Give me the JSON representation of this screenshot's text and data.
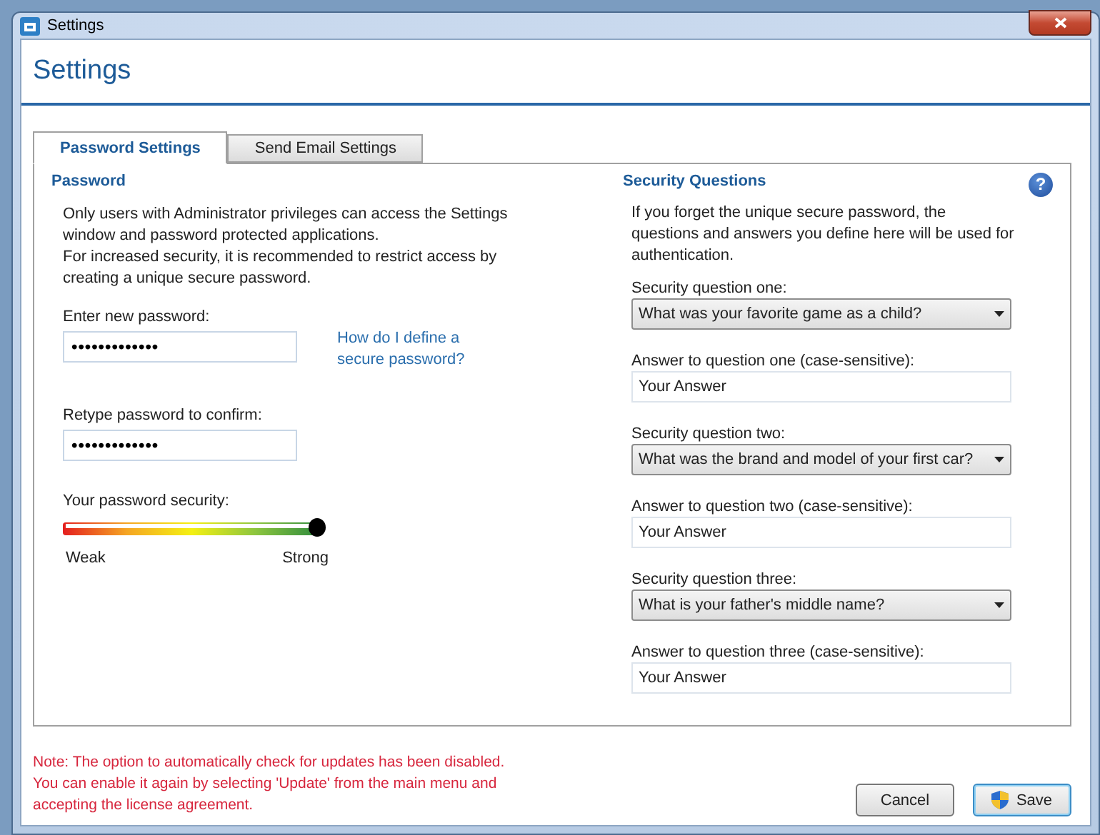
{
  "window": {
    "title": "Settings"
  },
  "header": "Settings",
  "tabs": [
    {
      "label": "Password Settings",
      "selected": true
    },
    {
      "label": "Send Email Settings",
      "selected": false
    }
  ],
  "password": {
    "heading": "Password",
    "intro": [
      "Only users with Administrator privileges can access the Settings window and password protected applications.",
      "For increased security, it is recommended to restrict access by creating a unique secure password."
    ],
    "new_label": "Enter new password:",
    "new_value": "•••••••••••••",
    "help_link": "How do I define a secure password?",
    "confirm_label": "Retype password to confirm:",
    "confirm_value": "•••••••••••••",
    "security_label": "Your password security:",
    "security": {
      "level": 1
    },
    "weak": "Weak",
    "strong": "Strong"
  },
  "security_questions": {
    "heading": "Security Questions",
    "help": "?",
    "intro": "If you forget the unique secure password, the questions and answers you define here will be used for authentication.",
    "items": [
      {
        "question_label": "Security question one:",
        "question": "What was your favorite game as a child?",
        "answer_label": "Answer to question one (case-sensitive):",
        "answer": "Your Answer"
      },
      {
        "question_label": "Security question two:",
        "question": "What was the brand and model of your first car?",
        "answer_label": "Answer to question two (case-sensitive):",
        "answer": "Your Answer"
      },
      {
        "question_label": "Security question three:",
        "question": "What is your father's middle name?",
        "answer_label": "Answer to question three (case-sensitive):",
        "answer": "Your Answer"
      }
    ]
  },
  "note": "Note: The option to automatically check for updates has been disabled. You can enable it again by selecting 'Update' from the main menu and accepting the license agreement.",
  "buttons": [
    {
      "label": "Cancel",
      "kind": "plain"
    },
    {
      "label": "Save",
      "kind": "shield"
    }
  ]
}
